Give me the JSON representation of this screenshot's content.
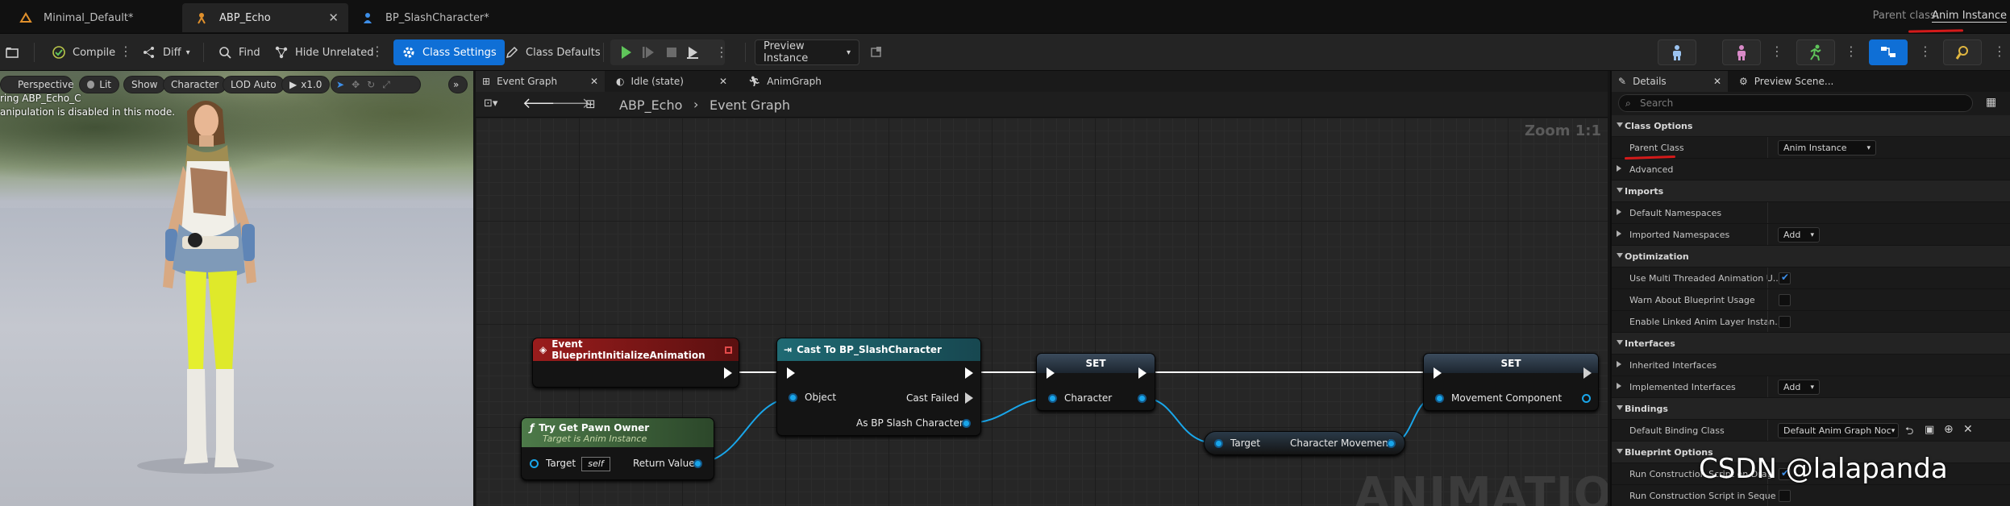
{
  "tabs": [
    {
      "label": "Minimal_Default*",
      "icon": "level-icon"
    },
    {
      "label": "ABP_Echo",
      "icon": "anim-blueprint-icon",
      "active": true
    },
    {
      "label": "BP_SlashCharacter*",
      "icon": "person-icon"
    }
  ],
  "parent_class": {
    "label": "Parent class:",
    "value": "Anim Instance"
  },
  "toolbar": {
    "compile": "Compile",
    "diff": "Diff",
    "find": "Find",
    "hide_unrelated": "Hide Unrelated",
    "class_settings": "Class Settings",
    "class_defaults": "Class Defaults",
    "preview_instance": "Preview Instance"
  },
  "viewport": {
    "perspective": "Perspective",
    "lit": "Lit",
    "show": "Show",
    "character": "Character",
    "lod": "LOD Auto",
    "speed": "x1.0",
    "info_line1": "ring ABP_Echo_C",
    "info_line2": "anipulation is disabled in this mode."
  },
  "graph": {
    "tabs": [
      "Event Graph",
      "Idle (state)",
      "AnimGraph"
    ],
    "breadcrumb": [
      "ABP_Echo",
      "Event Graph"
    ],
    "zoom": "Zoom 1:1",
    "watermark": "ANIMATION",
    "nodes": {
      "event_init": {
        "title": "Event BlueprintInitializeAnimation"
      },
      "pawn_owner": {
        "title": "Try Get Pawn Owner",
        "subtitle": "Target is Anim Instance",
        "target": "Target",
        "self": "self",
        "return": "Return Value"
      },
      "cast": {
        "title": "Cast To BP_SlashCharacter",
        "object": "Object",
        "failed": "Cast Failed",
        "as": "As BP Slash Character"
      },
      "set1": {
        "title": "SET",
        "pin": "Character"
      },
      "char_move": {
        "target": "Target",
        "output": "Character Movement"
      },
      "set2": {
        "title": "SET",
        "pin": "Movement Component"
      }
    }
  },
  "details": {
    "tabs": [
      "Details",
      "Preview Scene..."
    ],
    "search_placeholder": "Search",
    "sections": {
      "class_options": "Class Options",
      "parent_class": "Parent Class",
      "parent_class_value": "Anim Instance",
      "advanced": "Advanced",
      "imports": "Imports",
      "default_namespaces": "Default Namespaces",
      "imported_namespaces": "Imported Namespaces",
      "add": "Add",
      "optimization": "Optimization",
      "use_multi": "Use Multi Threaded Animation U...",
      "warn_about": "Warn About Blueprint Usage",
      "enable_linked": "Enable Linked Anim Layer Instan...",
      "interfaces": "Interfaces",
      "inherited_interfaces": "Inherited Interfaces",
      "implemented_interfaces": "Implemented Interfaces",
      "bindings": "Bindings",
      "default_binding": "Default Binding Class",
      "default_binding_value": "Default Anim Graph Noc",
      "blueprint_options": "Blueprint Options",
      "run_construction1": "Run Construction Script on Drag",
      "run_construction2": "Run Construction Script in Seque"
    }
  },
  "watermark": "CSDN @lalapanda"
}
